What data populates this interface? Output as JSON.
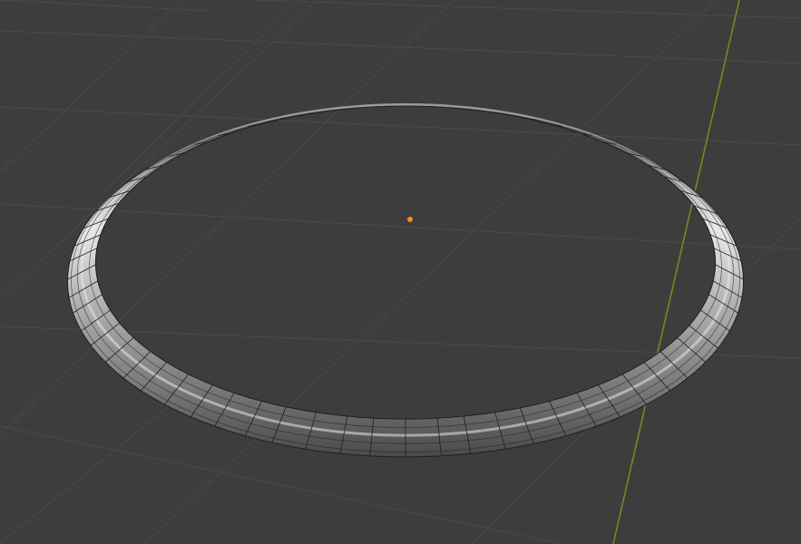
{
  "viewport": {
    "background_color": "#3d3d3d",
    "grid_line_color": "#4a4a4a",
    "y_axis_color": "#6b8e23",
    "origin_color": "#ff8c1a"
  },
  "object": {
    "type": "torus",
    "subdivisions_visible": true,
    "mesh_edge_color": "#1f1f1f",
    "surface_highlight_color": "#e8e8e8",
    "surface_shadow_color": "#4a4a4a",
    "surface_base_color": "#9a9a9a"
  },
  "icons": {
    "origin": "origin-point-icon"
  }
}
